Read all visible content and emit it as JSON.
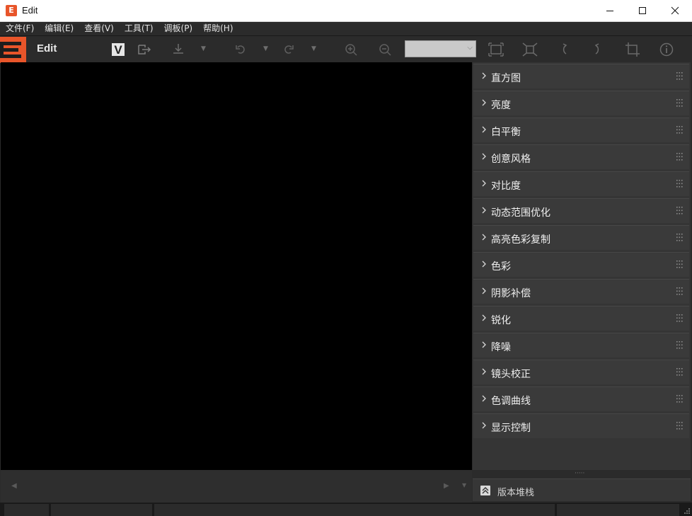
{
  "window": {
    "title": "Edit",
    "app_icon_letter": "E"
  },
  "menu": [
    {
      "label": "文件(F)"
    },
    {
      "label": "编辑(E)"
    },
    {
      "label": "查看(V)"
    },
    {
      "label": "工具(T)"
    },
    {
      "label": "调板(P)"
    },
    {
      "label": "帮助(H)"
    }
  ],
  "toolbar": {
    "mode_label": "Edit",
    "version_mark": "V",
    "zoom_value": "",
    "icons": [
      "logo-icon",
      "version-icon",
      "convert-output-icon",
      "save-icon",
      "undo-icon",
      "redo-icon",
      "zoom-in-icon",
      "zoom-out-icon",
      "fit-to-window-icon",
      "actual-size-icon",
      "rotate-left-icon",
      "rotate-right-icon",
      "crop-icon",
      "info-icon"
    ]
  },
  "palettes": [
    {
      "label": "直方图"
    },
    {
      "label": "亮度"
    },
    {
      "label": "白平衡"
    },
    {
      "label": "创意风格"
    },
    {
      "label": "对比度"
    },
    {
      "label": "动态范围优化"
    },
    {
      "label": "高亮色彩复制"
    },
    {
      "label": "色彩"
    },
    {
      "label": "阴影补偿"
    },
    {
      "label": "锐化"
    },
    {
      "label": "降噪"
    },
    {
      "label": "镜头校正"
    },
    {
      "label": "色调曲线"
    },
    {
      "label": "显示控制"
    }
  ],
  "version_stack": {
    "label": "版本堆栈"
  },
  "colors": {
    "accent": "#e8552a",
    "background": "#2b2b2b",
    "viewer": "#000000"
  }
}
